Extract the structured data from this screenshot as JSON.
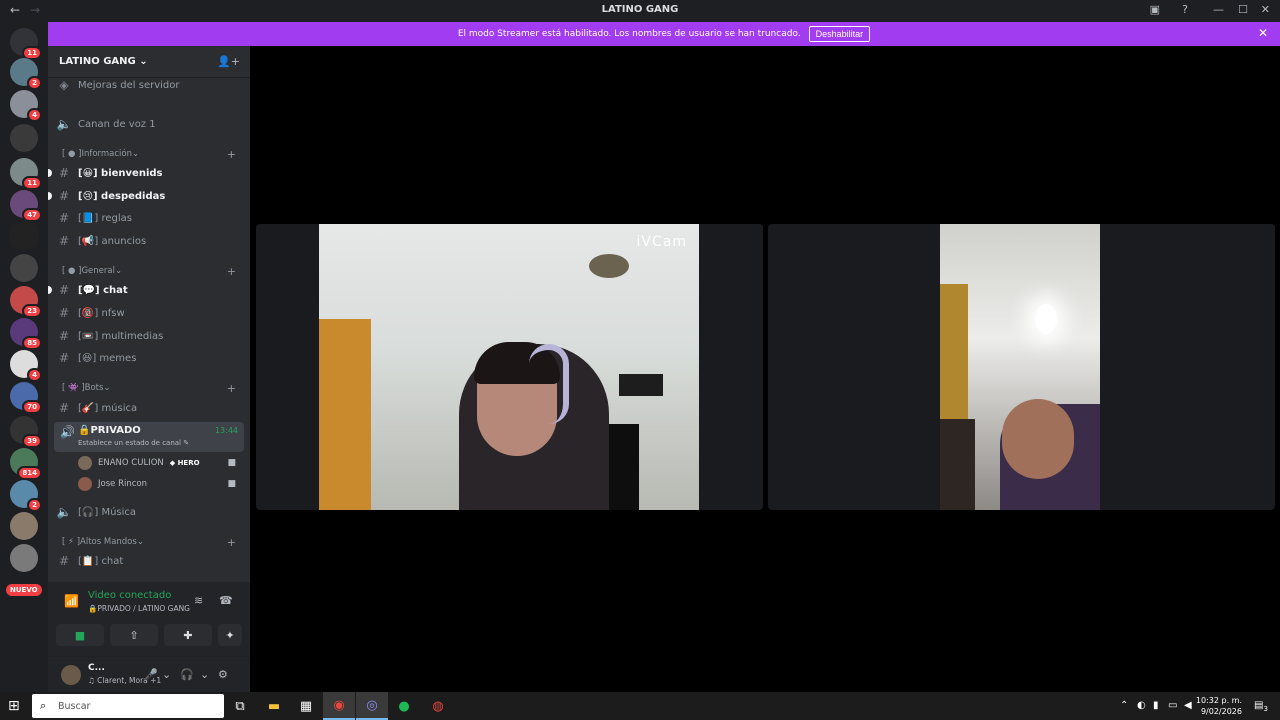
{
  "window": {
    "title": "LATINO GANG"
  },
  "banner": {
    "text": "El modo Streamer está habilitado. Los nombres de usuario se han truncado.",
    "button": "Deshabilitar"
  },
  "guilds": {
    "badges": [
      "11",
      "2",
      "4",
      "",
      "11",
      "47",
      "",
      "",
      "23",
      "85",
      "4",
      "70",
      "39",
      "814",
      "2",
      "",
      ""
    ],
    "new_label": "NUEVO"
  },
  "server": {
    "name": "LATINO GANG"
  },
  "channels": {
    "boosts": "Mejoras del servidor",
    "voice1": "Canan de voz 1",
    "cat_info": "Información",
    "bienvenidos": "bienvenids",
    "despedidas": "despedidas",
    "reglas": "reglas",
    "anuncios": "anuncios",
    "cat_general": "General",
    "chat": "chat",
    "nfsw": "nfsw",
    "multimedias": "multimedias",
    "memes": "memes",
    "cat_bots": "Bots",
    "musica_text": "música",
    "privado": "PRIVADO",
    "privado_sub": "Establece un estado de canal",
    "privado_time": "13:44",
    "user1": "ENANO CULION",
    "user1_badge": "HERO",
    "user2": "Jose Rincon",
    "musica_voice": "Música",
    "cat_altos": "Altos Mandos",
    "chat2": "chat"
  },
  "voice_panel": {
    "status": "Video conectado",
    "channel": "PRIVADO / LATINO GANG"
  },
  "user": {
    "name": "C...",
    "status": "Clarent, Mora +1"
  },
  "stage": {
    "watermark": "iVCam"
  },
  "taskbar": {
    "search_placeholder": "Buscar",
    "time": "10:32 p. m.",
    "date": "9/02/2026",
    "notif_count": "3"
  }
}
